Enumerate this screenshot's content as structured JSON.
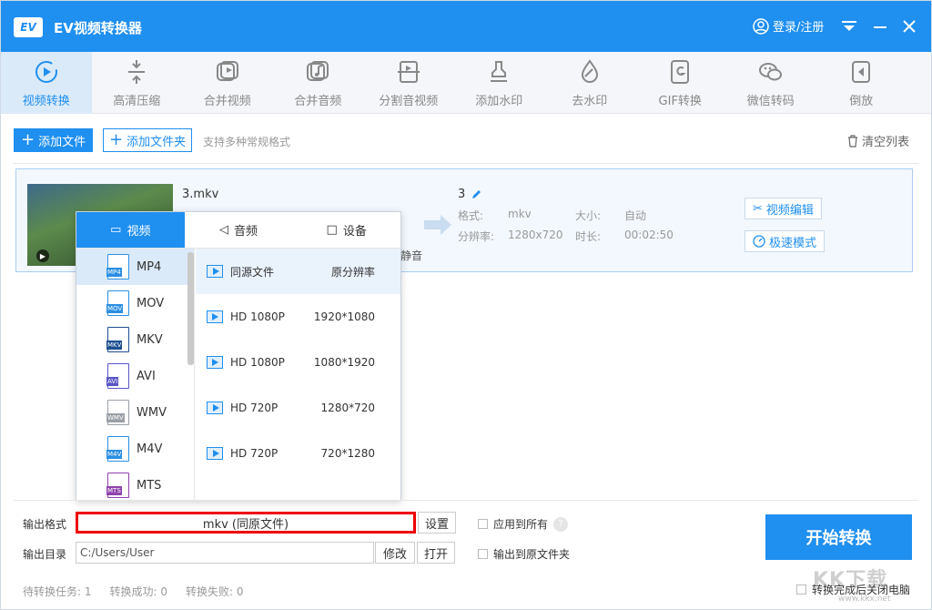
{
  "app": {
    "title": "EV视频转换器",
    "login": "登录/注册",
    "logo": "EV"
  },
  "toolbar": [
    {
      "label": "视频转换",
      "icon": "refresh-play-icon",
      "active": true
    },
    {
      "label": "高清压缩",
      "icon": "compress-icon"
    },
    {
      "label": "合并视频",
      "icon": "merge-video-icon"
    },
    {
      "label": "合并音频",
      "icon": "merge-audio-icon"
    },
    {
      "label": "分割音视频",
      "icon": "split-icon"
    },
    {
      "label": "添加水印",
      "icon": "stamp-icon"
    },
    {
      "label": "去水印",
      "icon": "drop-icon"
    },
    {
      "label": "GIF转换",
      "icon": "gif-icon"
    },
    {
      "label": "微信转码",
      "icon": "wechat-icon"
    },
    {
      "label": "倒放",
      "icon": "reverse-icon"
    }
  ],
  "actions": {
    "add_file": "添加文件",
    "add_folder": "添加文件夹",
    "hint": "支持多种常规格式",
    "clear": "清空列表"
  },
  "file": {
    "name": "3.mkv",
    "output_name": "3",
    "format_label": "格式:",
    "format": "mkv",
    "size_label": "大小:",
    "size": "自动",
    "res_label": "分辨率:",
    "resolution": "1280x720",
    "duration_label": "时长:",
    "duration": "00:02:50",
    "mute": "静音",
    "edit_btn": "视频编辑",
    "speed_btn": "极速模式"
  },
  "popup": {
    "tabs": [
      {
        "label": "视频",
        "active": true
      },
      {
        "label": "音频"
      },
      {
        "label": "设备"
      }
    ],
    "formats": [
      {
        "name": "MP4",
        "color": "#2b8fe3",
        "active": true
      },
      {
        "name": "MOV",
        "color": "#2b8fe3"
      },
      {
        "name": "MKV",
        "color": "#1d4f91"
      },
      {
        "name": "AVI",
        "color": "#5a56c8"
      },
      {
        "name": "WMV",
        "color": "#9aa0a6"
      },
      {
        "name": "M4V",
        "color": "#2b8fe3"
      },
      {
        "name": "MTS",
        "color": "#8e44ad"
      }
    ],
    "presets": [
      {
        "name": "同源文件",
        "res": "原分辨率",
        "active": true
      },
      {
        "name": "HD 1080P",
        "res": "1920*1080"
      },
      {
        "name": "HD 1080P",
        "res": "1080*1920"
      },
      {
        "name": "HD 720P",
        "res": "1280*720"
      },
      {
        "name": "HD 720P",
        "res": "720*1280"
      }
    ]
  },
  "bottom": {
    "out_format_label": "输出格式",
    "out_format_value": "mkv (同原文件)",
    "settings_btn": "设置",
    "apply_all": "应用到所有",
    "help": "?",
    "out_dir_label": "输出目录",
    "out_dir_value": "C:/Users/User",
    "modify_btn": "修改",
    "open_btn": "打开",
    "to_source": "输出到原文件夹",
    "start": "开始转换",
    "shutdown": "转换完成后关闭电脑",
    "stats": [
      {
        "label": "待转换任务:",
        "value": "1"
      },
      {
        "label": "转换成功:",
        "value": "0"
      },
      {
        "label": "转换失败:",
        "value": "0"
      }
    ]
  },
  "watermark": {
    "text": "KK下载",
    "url": "www.kkx.net"
  },
  "colors": {
    "accent": "#1f8ff0",
    "highlight": "#e00000"
  }
}
